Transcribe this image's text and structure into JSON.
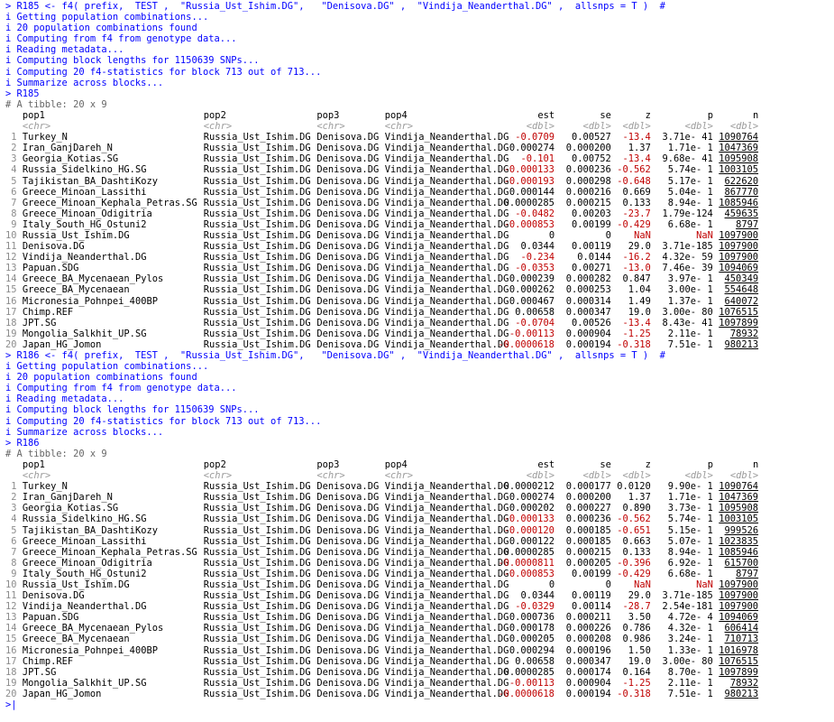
{
  "prompt": ">",
  "continue": "+",
  "blocks": [
    {
      "command": "R185 <- f4( prefix,  TEST ,  \"Russia_Ust_Ishim.DG\",   \"Denisova.DG\" ,  \"Vindija_Neanderthal.DG\" ,  allsnps = T )  #",
      "messages": [
        "i Getting population combinations...",
        "i 20 population combinations found",
        "i Computing from f4 from genotype data...",
        "i Reading metadata...",
        "i Computing block lengths for 1150639 SNPs...",
        "i Computing 20 f4-statistics for block 713 out of 713...",
        "i Summarize across blocks..."
      ],
      "print_cmd": "R185",
      "tibble_header": "# A tibble: 20 x 9",
      "columns": [
        "pop1",
        "pop2",
        "pop3",
        "pop4",
        "est",
        "se",
        "z",
        "p",
        "n"
      ],
      "types": [
        "<chr>",
        "<chr>",
        "<chr>",
        "<chr>",
        "<dbl>",
        "<dbl>",
        "<dbl>",
        "<dbl>",
        "<dbl>"
      ],
      "rows": [
        [
          "1",
          "Turkey_N",
          "Russia_Ust_Ishim.DG",
          "Denisova.DG",
          "Vindija_Neanderthal.DG",
          "-0.0709",
          "0.00527",
          "-13.4",
          "3.71e- 41",
          "1090764"
        ],
        [
          "2",
          "Iran_GanjDareh_N",
          "Russia_Ust_Ishim.DG",
          "Denisova.DG",
          "Vindija_Neanderthal.DG",
          "0.000274",
          "0.000200",
          "1.37",
          "1.71e- 1",
          "1047369"
        ],
        [
          "3",
          "Georgia_Kotias.SG",
          "Russia_Ust_Ishim.DG",
          "Denisova.DG",
          "Vindija_Neanderthal.DG",
          "-0.101",
          "0.00752",
          "-13.4",
          "9.68e- 41",
          "1095908"
        ],
        [
          "4",
          "Russia_Sidelkino_HG.SG",
          "Russia_Ust_Ishim.DG",
          "Denisova.DG",
          "Vindija_Neanderthal.DG",
          "-0.000133",
          "0.000236",
          "-0.562",
          "5.74e- 1",
          "1003105"
        ],
        [
          "5",
          "Tajikistan_BA_DashtiKozy",
          "Russia_Ust_Ishim.DG",
          "Denisova.DG",
          "Vindija_Neanderthal.DG",
          "-0.000193",
          "0.000298",
          "-0.648",
          "5.17e- 1",
          "622620"
        ],
        [
          "6",
          "Greece_Minoan_Lassithi",
          "Russia_Ust_Ishim.DG",
          "Denisova.DG",
          "Vindija_Neanderthal.DG",
          "0.000144",
          "0.000216",
          "0.669",
          "5.04e- 1",
          "867770"
        ],
        [
          "7",
          "Greece_Minoan_Kephala_Petras.SG",
          "Russia_Ust_Ishim.DG",
          "Denisova.DG",
          "Vindija_Neanderthal.DG",
          "0.0000285",
          "0.000215",
          "0.133",
          "8.94e- 1",
          "1085946"
        ],
        [
          "8",
          "Greece_Minoan_Odigitria",
          "Russia_Ust_Ishim.DG",
          "Denisova.DG",
          "Vindija_Neanderthal.DG",
          "-0.0482",
          "0.00203",
          "-23.7",
          "1.79e-124",
          "459635"
        ],
        [
          "9",
          "Italy_South_HG_Ostuni2",
          "Russia_Ust_Ishim.DG",
          "Denisova.DG",
          "Vindija_Neanderthal.DG",
          "-0.000853",
          "0.00199",
          "-0.429",
          "6.68e- 1",
          "8797"
        ],
        [
          "10",
          "Russia_Ust_Ishim.DG",
          "Russia_Ust_Ishim.DG",
          "Denisova.DG",
          "Vindija_Neanderthal.DG",
          "0",
          "0",
          "NaN",
          "NaN",
          "1097900"
        ],
        [
          "11",
          "Denisova.DG",
          "Russia_Ust_Ishim.DG",
          "Denisova.DG",
          "Vindija_Neanderthal.DG",
          "0.0344",
          "0.00119",
          "29.0",
          "3.71e-185",
          "1097900"
        ],
        [
          "12",
          "Vindija_Neanderthal.DG",
          "Russia_Ust_Ishim.DG",
          "Denisova.DG",
          "Vindija_Neanderthal.DG",
          "-0.234",
          "0.0144",
          "-16.2",
          "4.32e- 59",
          "1097900"
        ],
        [
          "13",
          "Papuan.SDG",
          "Russia_Ust_Ishim.DG",
          "Denisova.DG",
          "Vindija_Neanderthal.DG",
          "-0.0353",
          "0.00271",
          "-13.0",
          "7.46e- 39",
          "1094069"
        ],
        [
          "14",
          "Greece_BA_Mycenaean_Pylos",
          "Russia_Ust_Ishim.DG",
          "Denisova.DG",
          "Vindija_Neanderthal.DG",
          "0.000239",
          "0.000282",
          "0.847",
          "3.97e- 1",
          "450349"
        ],
        [
          "15",
          "Greece_BA_Mycenaean",
          "Russia_Ust_Ishim.DG",
          "Denisova.DG",
          "Vindija_Neanderthal.DG",
          "0.000262",
          "0.000253",
          "1.04",
          "3.00e- 1",
          "554648"
        ],
        [
          "16",
          "Micronesia_Pohnpei_400BP",
          "Russia_Ust_Ishim.DG",
          "Denisova.DG",
          "Vindija_Neanderthal.DG",
          "0.000467",
          "0.000314",
          "1.49",
          "1.37e- 1",
          "640072"
        ],
        [
          "17",
          "Chimp.REF",
          "Russia_Ust_Ishim.DG",
          "Denisova.DG",
          "Vindija_Neanderthal.DG",
          "0.00658",
          "0.000347",
          "19.0",
          "3.00e- 80",
          "1076515"
        ],
        [
          "18",
          "JPT.SG",
          "Russia_Ust_Ishim.DG",
          "Denisova.DG",
          "Vindija_Neanderthal.DG",
          "-0.0704",
          "0.00526",
          "-13.4",
          "8.43e- 41",
          "1097899"
        ],
        [
          "19",
          "Mongolia_Salkhit_UP.SG",
          "Russia_Ust_Ishim.DG",
          "Denisova.DG",
          "Vindija_Neanderthal.DG",
          "-0.00113",
          "0.000904",
          "-1.25",
          "2.11e- 1",
          "78932"
        ],
        [
          "20",
          "Japan_HG_Jomon",
          "Russia_Ust_Ishim.DG",
          "Denisova.DG",
          "Vindija_Neanderthal.DG",
          "-0.0000618",
          "0.000194",
          "-0.318",
          "7.51e- 1",
          "980213"
        ]
      ]
    },
    {
      "command": "R186 <- f4( prefix,  TEST ,  \"Russia_Ust_Ishim.DG\",   \"Denisova.DG\" ,  \"Vindija_Neanderthal.DG\" ,  allsnps = T )  #",
      "messages": [
        "i Getting population combinations...",
        "i 20 population combinations found",
        "i Computing from f4 from genotype data...",
        "i Reading metadata...",
        "i Computing block lengths for 1150639 SNPs...",
        "i Computing 20 f4-statistics for block 713 out of 713...",
        "i Summarize across blocks..."
      ],
      "print_cmd": "R186",
      "tibble_header": "# A tibble: 20 x 9",
      "columns": [
        "pop1",
        "pop2",
        "pop3",
        "pop4",
        "est",
        "se",
        "z",
        "p",
        "n"
      ],
      "types": [
        "<chr>",
        "<chr>",
        "<chr>",
        "<chr>",
        "<dbl>",
        "<dbl>",
        "<dbl>",
        "<dbl>",
        "<dbl>"
      ],
      "rows": [
        [
          "1",
          "Turkey_N",
          "Russia_Ust_Ishim.DG",
          "Denisova.DG",
          "Vindija_Neanderthal.DG",
          "0.0000212",
          "0.000177",
          "0.0120",
          "9.90e- 1",
          "1090764"
        ],
        [
          "2",
          "Iran_GanjDareh_N",
          "Russia_Ust_Ishim.DG",
          "Denisova.DG",
          "Vindija_Neanderthal.DG",
          "0.000274",
          "0.000200",
          "1.37",
          "1.71e- 1",
          "1047369"
        ],
        [
          "3",
          "Georgia_Kotias.SG",
          "Russia_Ust_Ishim.DG",
          "Denisova.DG",
          "Vindija_Neanderthal.DG",
          "0.000202",
          "0.000227",
          "0.890",
          "3.73e- 1",
          "1095908"
        ],
        [
          "4",
          "Russia_Sidelkino_HG.SG",
          "Russia_Ust_Ishim.DG",
          "Denisova.DG",
          "Vindija_Neanderthal.DG",
          "-0.000133",
          "0.000236",
          "-0.562",
          "5.74e- 1",
          "1003105"
        ],
        [
          "5",
          "Tajikistan_BA_DashtiKozy",
          "Russia_Ust_Ishim.DG",
          "Denisova.DG",
          "Vindija_Neanderthal.DG",
          "-0.000120",
          "0.000185",
          "-0.651",
          "5.15e- 1",
          "999526"
        ],
        [
          "6",
          "Greece_Minoan_Lassithi",
          "Russia_Ust_Ishim.DG",
          "Denisova.DG",
          "Vindija_Neanderthal.DG",
          "0.000122",
          "0.000185",
          "0.663",
          "5.07e- 1",
          "1023835"
        ],
        [
          "7",
          "Greece_Minoan_Kephala_Petras.SG",
          "Russia_Ust_Ishim.DG",
          "Denisova.DG",
          "Vindija_Neanderthal.DG",
          "0.0000285",
          "0.000215",
          "0.133",
          "8.94e- 1",
          "1085946"
        ],
        [
          "8",
          "Greece_Minoan_Odigitria",
          "Russia_Ust_Ishim.DG",
          "Denisova.DG",
          "Vindija_Neanderthal.DG",
          "-0.0000811",
          "0.000205",
          "-0.396",
          "6.92e- 1",
          "615700"
        ],
        [
          "9",
          "Italy_South_HG_Ostuni2",
          "Russia_Ust_Ishim.DG",
          "Denisova.DG",
          "Vindija_Neanderthal.DG",
          "-0.000853",
          "0.00199",
          "-0.429",
          "6.68e- 1",
          "8797"
        ],
        [
          "10",
          "Russia_Ust_Ishim.DG",
          "Russia_Ust_Ishim.DG",
          "Denisova.DG",
          "Vindija_Neanderthal.DG",
          "0",
          "0",
          "NaN",
          "NaN",
          "1097900"
        ],
        [
          "11",
          "Denisova.DG",
          "Russia_Ust_Ishim.DG",
          "Denisova.DG",
          "Vindija_Neanderthal.DG",
          "0.0344",
          "0.00119",
          "29.0",
          "3.71e-185",
          "1097900"
        ],
        [
          "12",
          "Vindija_Neanderthal.DG",
          "Russia_Ust_Ishim.DG",
          "Denisova.DG",
          "Vindija_Neanderthal.DG",
          "-0.0329",
          "0.00114",
          "-28.7",
          "2.54e-181",
          "1097900"
        ],
        [
          "13",
          "Papuan.SDG",
          "Russia_Ust_Ishim.DG",
          "Denisova.DG",
          "Vindija_Neanderthal.DG",
          "0.000736",
          "0.000211",
          "3.50",
          "4.72e- 4",
          "1094069"
        ],
        [
          "14",
          "Greece_BA_Mycenaean_Pylos",
          "Russia_Ust_Ishim.DG",
          "Denisova.DG",
          "Vindija_Neanderthal.DG",
          "0.000178",
          "0.000226",
          "0.786",
          "4.32e- 1",
          "606414"
        ],
        [
          "15",
          "Greece_BA_Mycenaean",
          "Russia_Ust_Ishim.DG",
          "Denisova.DG",
          "Vindija_Neanderthal.DG",
          "0.000205",
          "0.000208",
          "0.986",
          "3.24e- 1",
          "710713"
        ],
        [
          "16",
          "Micronesia_Pohnpei_400BP",
          "Russia_Ust_Ishim.DG",
          "Denisova.DG",
          "Vindija_Neanderthal.DG",
          "0.000294",
          "0.000196",
          "1.50",
          "1.33e- 1",
          "1016978"
        ],
        [
          "17",
          "Chimp.REF",
          "Russia_Ust_Ishim.DG",
          "Denisova.DG",
          "Vindija_Neanderthal.DG",
          "0.00658",
          "0.000347",
          "19.0",
          "3.00e- 80",
          "1076515"
        ],
        [
          "18",
          "JPT.SG",
          "Russia_Ust_Ishim.DG",
          "Denisova.DG",
          "Vindija_Neanderthal.DG",
          "0.0000285",
          "0.000174",
          "0.164",
          "8.70e- 1",
          "1097899"
        ],
        [
          "19",
          "Mongolia_Salkhit_UP.SG",
          "Russia_Ust_Ishim.DG",
          "Denisova.DG",
          "Vindija_Neanderthal.DG",
          "-0.00113",
          "0.000904",
          "-1.25",
          "2.11e- 1",
          "78932"
        ],
        [
          "20",
          "Japan_HG_Jomon",
          "Russia_Ust_Ishim.DG",
          "Denisova.DG",
          "Vindija_Neanderthal.DG",
          "-0.0000618",
          "0.000194",
          "-0.318",
          "7.51e- 1",
          "980213"
        ]
      ]
    }
  ],
  "colors": {
    "command": "#0000ff",
    "message": "#0000ff",
    "comment": "#666666",
    "negative": "#c00000",
    "type_label": "#9a9a9a",
    "row_number": "#8c8c8c"
  }
}
